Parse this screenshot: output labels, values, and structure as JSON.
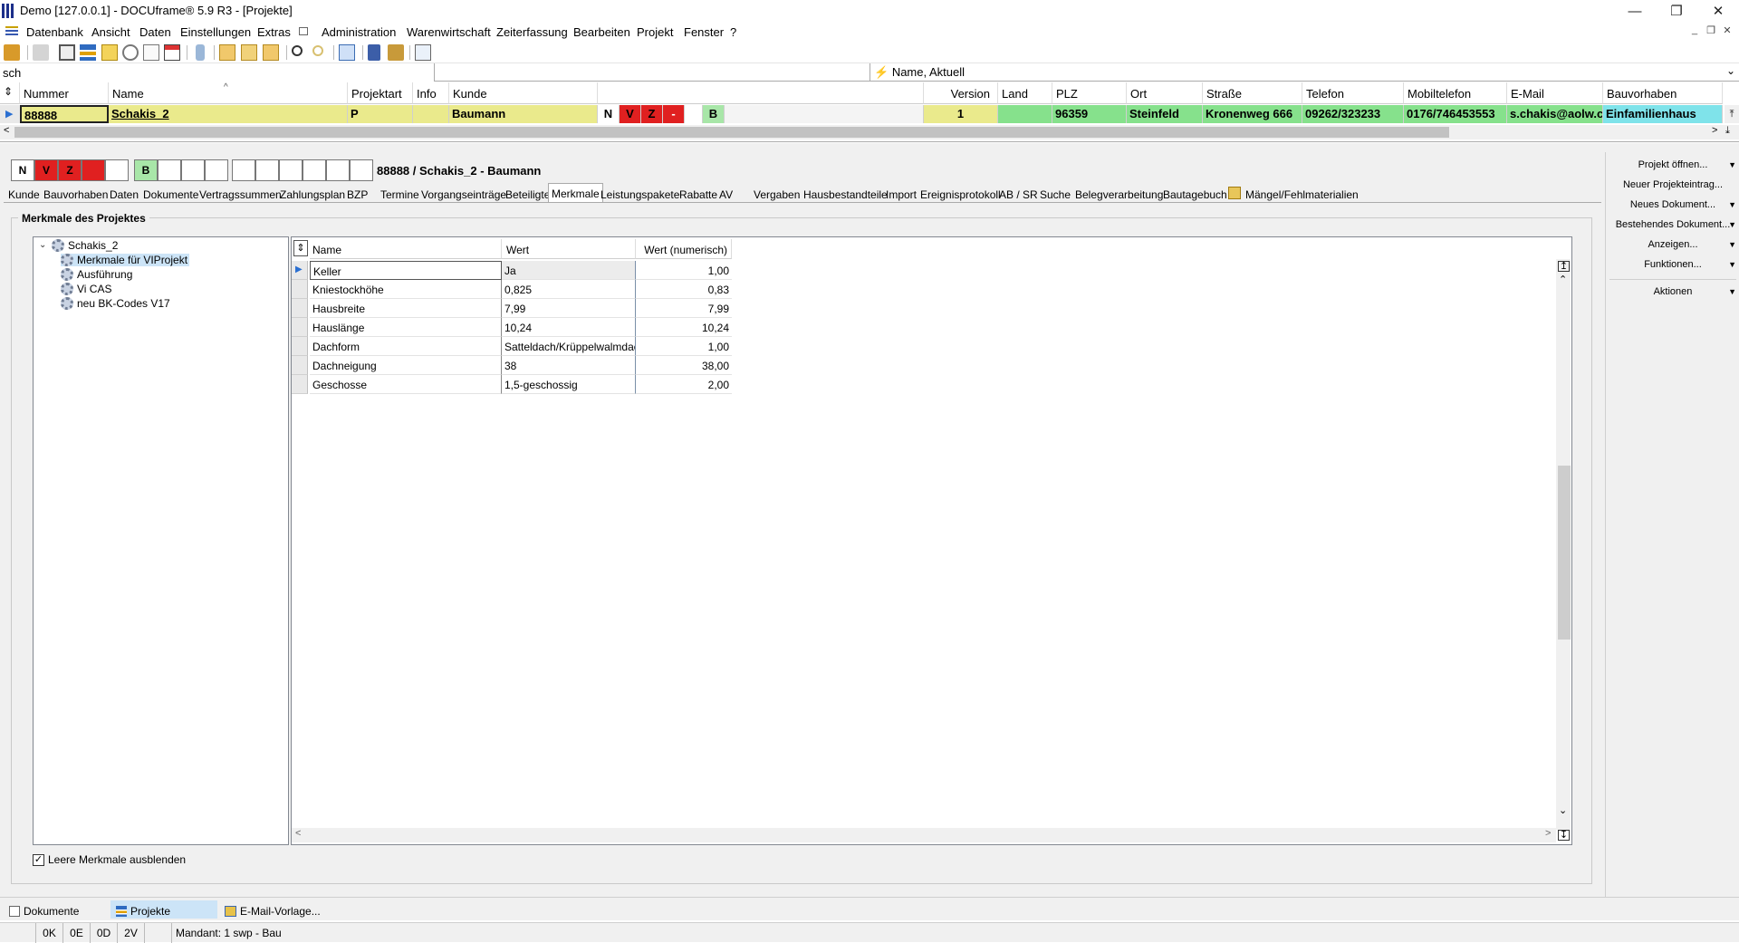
{
  "window": {
    "title": "Demo [127.0.0.1] - DOCUframe® 5.9 R3 - [Projekte]"
  },
  "menu": [
    "Datenbank",
    "Ansicht",
    "Daten",
    "Einstellungen",
    "Extras",
    "Administration",
    "Warenwirtschaft",
    "Zeiterfassung",
    "Bearbeiten",
    "Projekt",
    "Fenster",
    "?"
  ],
  "search": {
    "value": "sch",
    "sort_label": "Name, Aktuell"
  },
  "grid": {
    "headers": [
      "Nummer",
      "Name",
      "Projektart",
      "Info",
      "Kunde",
      "Version",
      "Land",
      "PLZ",
      "Ort",
      "Straße",
      "Telefon",
      "Mobiltelefon",
      "E-Mail",
      "Bauvorhaben"
    ],
    "row": {
      "nummer": "88888",
      "name": "Schakis_2",
      "projektart": "P",
      "info": "",
      "kunde": "Baumann",
      "flag_n": "N",
      "flag_v": "V",
      "flag_z": "Z",
      "flag_minus": "-",
      "flag_b": "B",
      "version": "1",
      "land": "",
      "plz": "96359",
      "ort": "Steinfeld",
      "strasse": "Kronenweg 666",
      "telefon": "09262/323233",
      "mobil": "0176/746453553",
      "email": "s.chakis@aolw.cor",
      "bauvorhaben": "Einfamilienhaus"
    }
  },
  "detail": {
    "flags": [
      "N",
      "V",
      "Z",
      "",
      "",
      "B",
      "",
      "",
      "",
      "",
      "",
      "",
      "",
      "",
      "",
      ""
    ],
    "heading": "88888 / Schakis_2 - Baumann",
    "tabs": [
      "Kunde",
      "Bauvorhaben",
      "Daten",
      "Dokumente",
      "Vertragssummen",
      "Zahlungsplan",
      "BZP",
      "Termine",
      "Vorgangseinträge",
      "Beteiligte",
      "Merkmale",
      "Leistungspakete",
      "Rabatte",
      "AV",
      "Vergaben",
      "Hausbestandteile",
      "Import",
      "Ereignisprotokoll",
      "AB / SR",
      "Suche",
      "Belegverarbeitung",
      "Bautagebuch",
      "Mängel/Fehlmaterialien"
    ],
    "active_tab": "Merkmale",
    "group_title": "Merkmale des Projektes",
    "tree": {
      "root": "Schakis_2",
      "children": [
        "Merkmale für VIProjekt",
        "Ausführung",
        "Vi CAS",
        "neu BK-Codes V17"
      ]
    },
    "table": {
      "columns": [
        "Name",
        "Wert",
        "Wert (numerisch)"
      ],
      "rows": [
        {
          "name": "Keller",
          "wert": "Ja",
          "num": "1,00"
        },
        {
          "name": "Kniestockhöhe",
          "wert": "0,825",
          "num": "0,83"
        },
        {
          "name": "Hausbreite",
          "wert": "7,99",
          "num": "7,99"
        },
        {
          "name": "Hauslänge",
          "wert": "10,24",
          "num": "10,24"
        },
        {
          "name": "Dachform",
          "wert": "Satteldach/Krüppelwalmdach",
          "num": "1,00"
        },
        {
          "name": "Dachneigung",
          "wert": "38",
          "num": "38,00"
        },
        {
          "name": "Geschosse",
          "wert": "1,5-geschossig",
          "num": "2,00"
        }
      ]
    },
    "hide_empty_label": "Leere Merkmale ausblenden"
  },
  "actions": [
    "Projekt öffnen...",
    "Neuer Projekteintrag...",
    "Neues Dokument...",
    "Bestehendes Dokument...",
    "Anzeigen...",
    "Funktionen...",
    "Aktionen"
  ],
  "bottom_tabs": [
    "Dokumente",
    "Projekte",
    "E-Mail-Vorlage..."
  ],
  "status": [
    "0K",
    "0E",
    "0D",
    "2V",
    "Mandant: 1 swp - Bau"
  ],
  "colors": {
    "row_yellow": "#eaea8c",
    "row_green": "#86e18c",
    "row_cyan": "#7fe3ea",
    "flag_red": "#e02020",
    "flag_green": "#a8e6a8",
    "selection": "#cce4f7"
  }
}
